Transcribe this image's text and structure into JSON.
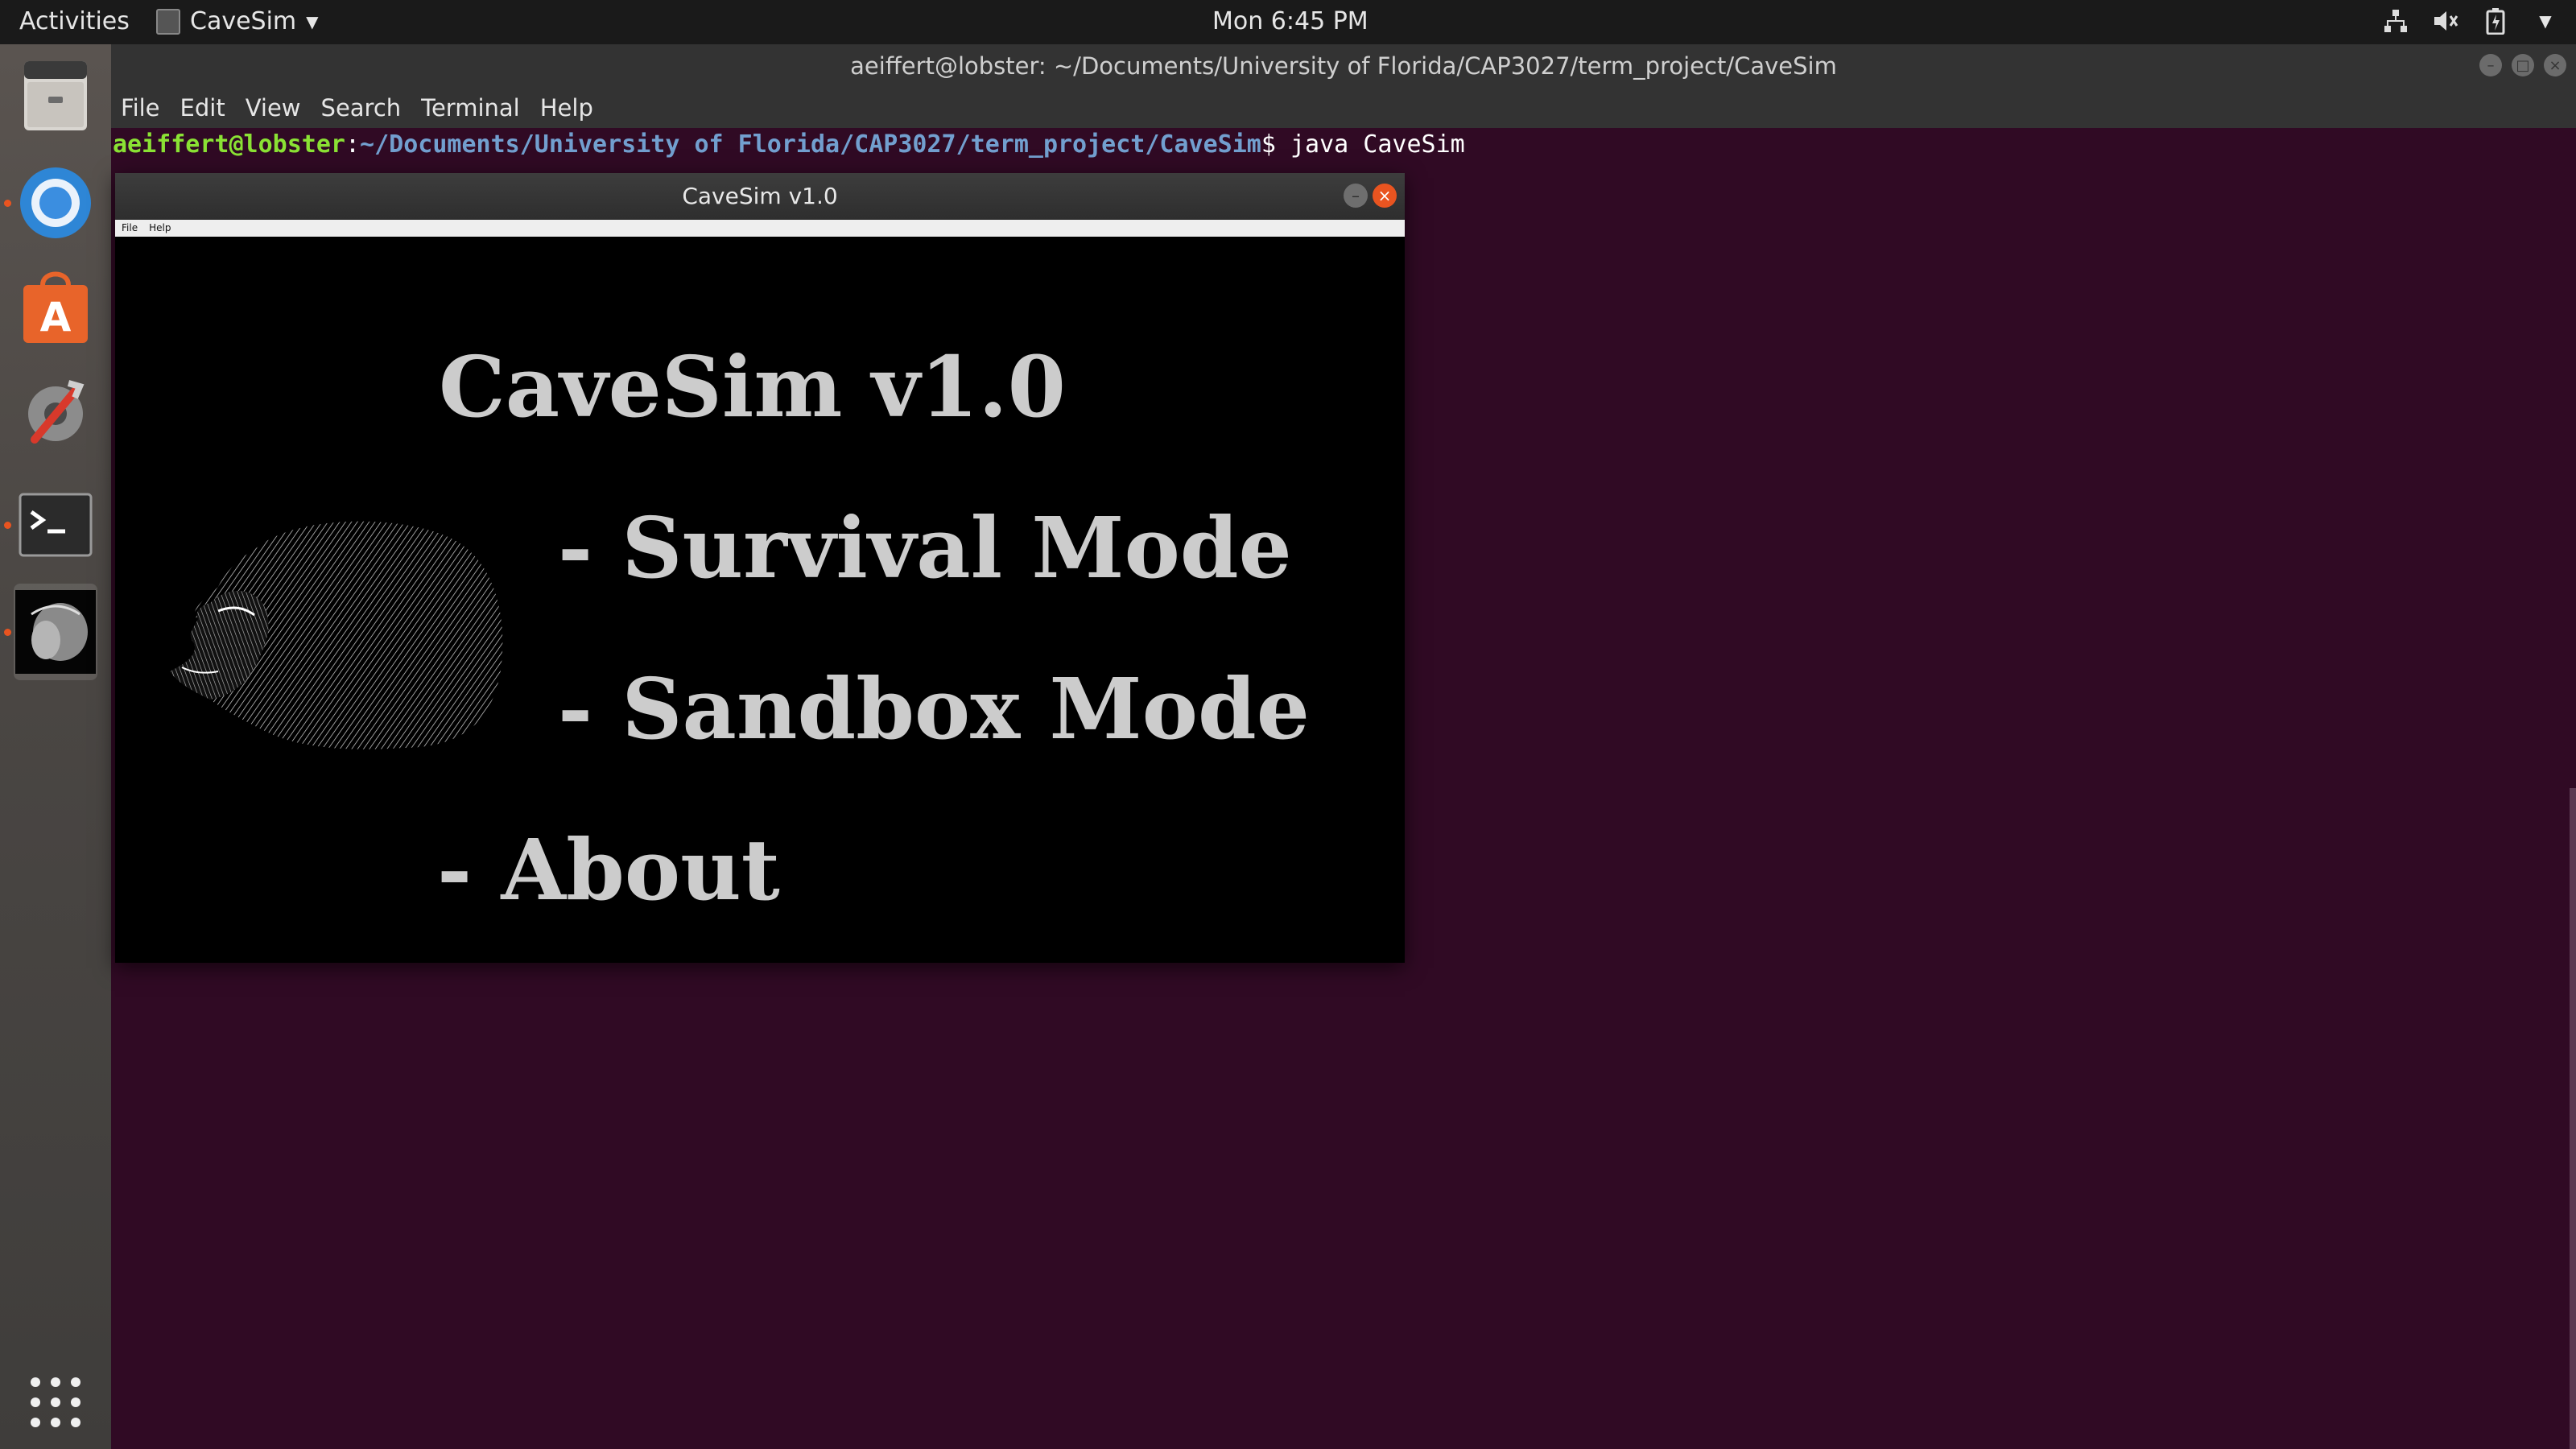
{
  "topbar": {
    "activities": "Activities",
    "app_name": "CaveSim",
    "clock": "Mon  6:45 PM"
  },
  "dock": {
    "items": [
      {
        "name": "files",
        "icon": "file-cabinet-icon"
      },
      {
        "name": "chromium",
        "icon": "chromium-icon",
        "running": true
      },
      {
        "name": "software",
        "icon": "software-center-icon"
      },
      {
        "name": "settings",
        "icon": "settings-tools-icon"
      },
      {
        "name": "terminal",
        "icon": "terminal-icon",
        "running": true
      },
      {
        "name": "cavesim",
        "icon": "caveman-icon",
        "running": true,
        "active": true
      },
      {
        "name": "apps-grid",
        "icon": "app-grid-icon"
      }
    ]
  },
  "terminal": {
    "title": "aeiffert@lobster: ~/Documents/University of Florida/CAP3027/term_project/CaveSim",
    "menu": [
      "File",
      "Edit",
      "View",
      "Search",
      "Terminal",
      "Help"
    ],
    "prompt_user": "aeiffert@lobster",
    "prompt_sep": ":",
    "prompt_path": "~/Documents/University of Florida/CAP3027/term_project/CaveSim",
    "prompt_symbol": "$ ",
    "command": "java CaveSim",
    "colors": {
      "background": "#300a24",
      "user": "#8ae234",
      "path": "#729fcf"
    }
  },
  "cavesim": {
    "window_title": "CaveSim v1.0",
    "menu": [
      "File",
      "Help"
    ],
    "heading": "CaveSim v1.0",
    "options": [
      "- Survival Mode",
      "- Sandbox Mode",
      "- About"
    ],
    "close_color": "#e95420"
  }
}
